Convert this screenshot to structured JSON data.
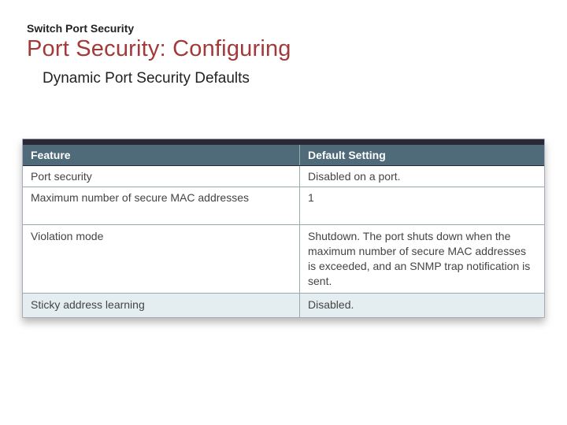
{
  "header": {
    "kicker": "Switch Port Security",
    "title": "Port Security: Configuring",
    "subtitle": "Dynamic Port Security Defaults"
  },
  "table": {
    "columns": [
      "Feature",
      "Default Setting"
    ],
    "rows": [
      {
        "feature": "Port security",
        "setting": "Disabled on a port."
      },
      {
        "feature": "Maximum number of secure MAC addresses",
        "setting": "1"
      },
      {
        "feature": "Violation mode",
        "setting": "Shutdown. The port shuts down when the maximum number of secure MAC addresses is exceeded, and an SNMP trap notification is sent."
      },
      {
        "feature": "Sticky address learning",
        "setting": "Disabled."
      }
    ]
  }
}
